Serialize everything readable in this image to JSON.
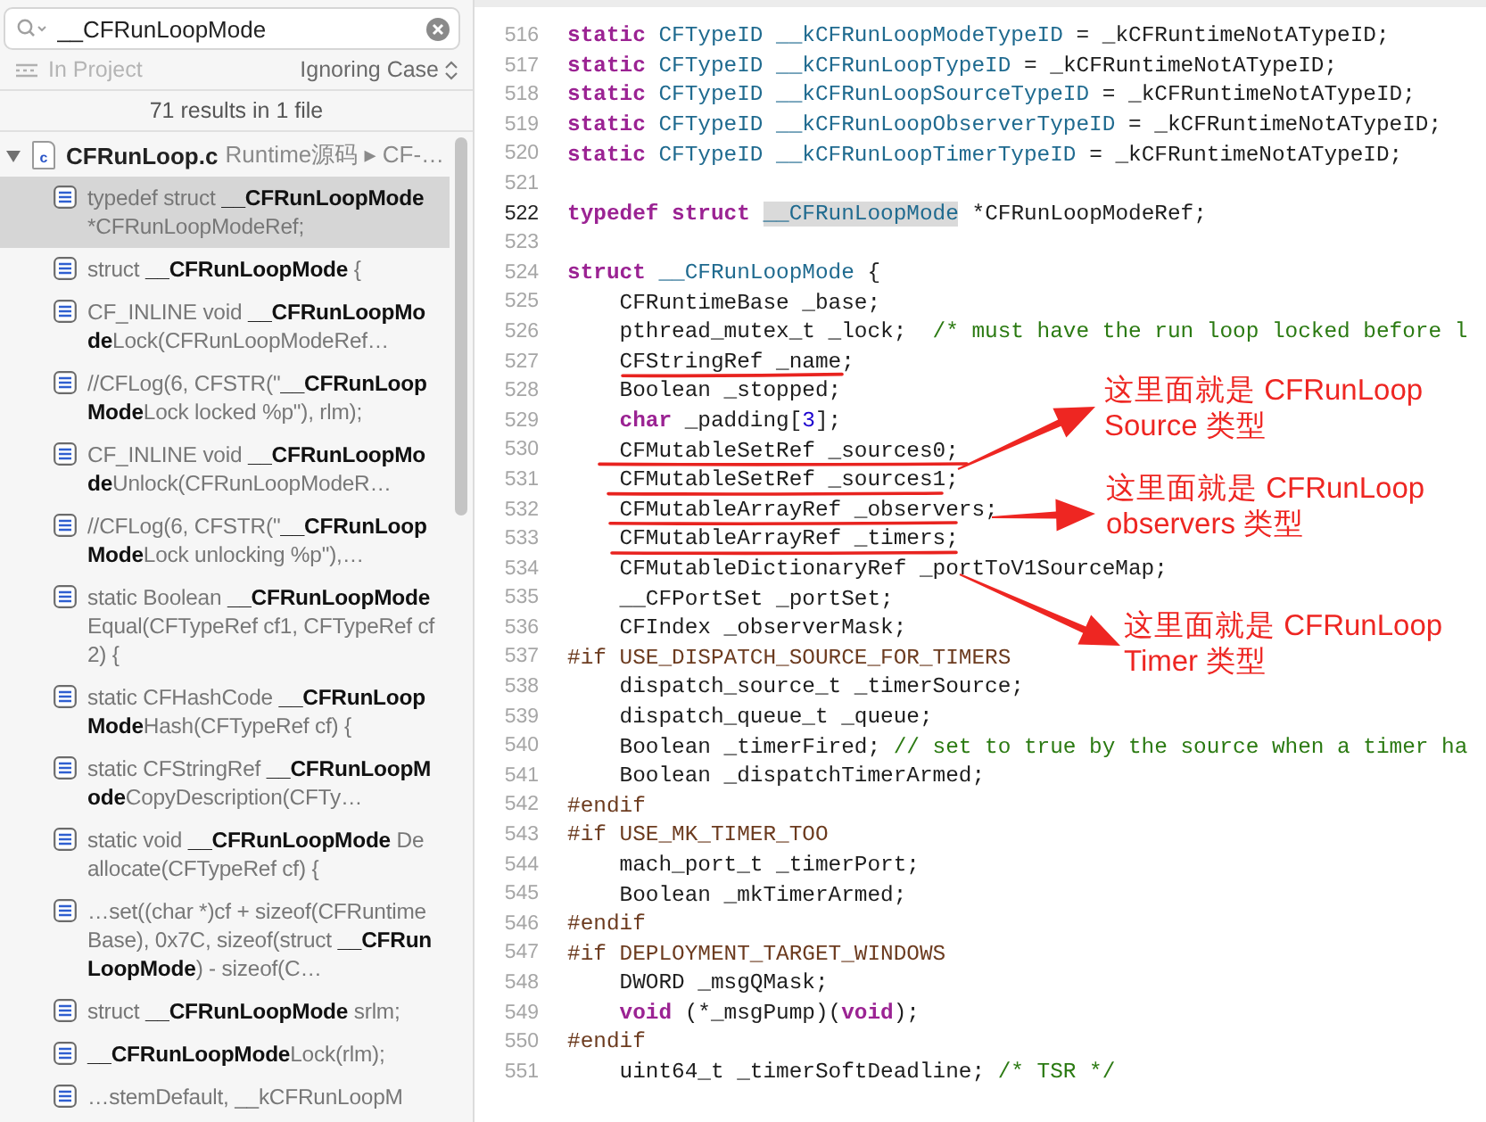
{
  "search": {
    "value": "__CFRunLoopMode"
  },
  "scope": {
    "label": "In Project"
  },
  "matching": {
    "label": "Ignoring Case"
  },
  "summary": "71 results in 1 file",
  "file": {
    "name": "CFRunLoop.c",
    "type_letter": "c",
    "path": "Runtime源码 ▸ CF-…",
    "expanded": true
  },
  "results": [
    {
      "text": "typedef struct **__CFRunLoopMode** *CFRunLoopModeRef;",
      "selected": true
    },
    {
      "text": "struct **__CFRunLoopMode** {",
      "selected": false
    },
    {
      "text": "CF_INLINE void **__CFRunLoopMode**Lock(CFRunLoopModeRef…",
      "selected": false
    },
    {
      "text": "//CFLog(6, CFSTR(\"**__CFRunLoopMode**Lock locked %p\"), rlm);",
      "selected": false
    },
    {
      "text": "CF_INLINE void **__CFRunLoopMode**Unlock(CFRunLoopModeR…",
      "selected": false
    },
    {
      "text": "//CFLog(6, CFSTR(\"**__CFRunLoopMode**Lock unlocking %p\"),…",
      "selected": false
    },
    {
      "text": "static Boolean **__CFRunLoopMode**Equal(CFTypeRef cf1, CFTypeRef cf2) {",
      "selected": false
    },
    {
      "text": "static CFHashCode **__CFRunLoopMode**Hash(CFTypeRef cf) {",
      "selected": false
    },
    {
      "text": "static CFStringRef **__CFRunLoopMode**CopyDescription(CFTy…",
      "selected": false
    },
    {
      "text": "static void **__CFRunLoopMode** Deallocate(CFTypeRef cf) {",
      "selected": false
    },
    {
      "text": "…set((char *)cf + sizeof(CFRuntimeBase), 0x7C, sizeof(struct **__CFRunLoopMode**) - sizeof(C…",
      "selected": false
    },
    {
      "text": "struct **__CFRunLoopMode** srlm;",
      "selected": false
    },
    {
      "text": "**__CFRunLoopMode**Lock(rlm);",
      "selected": false
    },
    {
      "text": "…stemDefault, __kCFRunLoopM",
      "selected": false
    }
  ],
  "code": {
    "lines": [
      {
        "number": "516",
        "current": false,
        "tokens": [
          {
            "kind": "kw",
            "text": "static"
          },
          {
            "kind": "type",
            "text": " CFTypeID"
          },
          {
            "kind": "type",
            "text": " __kCFRunLoopModeTypeID"
          },
          {
            "kind": "plain",
            "text": " = _kCFRuntimeNotATypeID;"
          }
        ]
      },
      {
        "number": "517",
        "current": false,
        "tokens": [
          {
            "kind": "kw",
            "text": "static"
          },
          {
            "kind": "type",
            "text": " CFTypeID"
          },
          {
            "kind": "type",
            "text": " __kCFRunLoopTypeID"
          },
          {
            "kind": "plain",
            "text": " = _kCFRuntimeNotATypeID;"
          }
        ]
      },
      {
        "number": "518",
        "current": false,
        "tokens": [
          {
            "kind": "kw",
            "text": "static"
          },
          {
            "kind": "type",
            "text": " CFTypeID"
          },
          {
            "kind": "type",
            "text": " __kCFRunLoopSourceTypeID"
          },
          {
            "kind": "plain",
            "text": " = _kCFRuntimeNotATypeID;"
          }
        ]
      },
      {
        "number": "519",
        "current": false,
        "tokens": [
          {
            "kind": "kw",
            "text": "static"
          },
          {
            "kind": "type",
            "text": " CFTypeID"
          },
          {
            "kind": "type",
            "text": " __kCFRunLoopObserverTypeID"
          },
          {
            "kind": "plain",
            "text": " = _kCFRuntimeNotATypeID;"
          }
        ]
      },
      {
        "number": "520",
        "current": false,
        "tokens": [
          {
            "kind": "kw",
            "text": "static"
          },
          {
            "kind": "type",
            "text": " CFTypeID"
          },
          {
            "kind": "type",
            "text": " __kCFRunLoopTimerTypeID"
          },
          {
            "kind": "plain",
            "text": " = _kCFRuntimeNotATypeID;"
          }
        ]
      },
      {
        "number": "521",
        "current": false
      },
      {
        "number": "522",
        "current": true,
        "tokens": [
          {
            "kind": "kw",
            "text": "typedef"
          },
          {
            "kind": "kw",
            "text": " struct "
          },
          {
            "kind": "match",
            "text": "__CFRunLoopMode"
          },
          {
            "kind": "plain",
            "text": " *CFRunLoopModeRef;"
          }
        ]
      },
      {
        "number": "523",
        "current": false
      },
      {
        "number": "524",
        "current": false,
        "tokens": [
          {
            "kind": "kw",
            "text": "struct"
          },
          {
            "kind": "type",
            "text": " __CFRunLoopMode"
          },
          {
            "kind": "plain",
            "text": " {"
          }
        ]
      },
      {
        "number": "525",
        "current": false,
        "tokens": [
          {
            "kind": "plain",
            "text": "    CFRuntimeBase _base;"
          }
        ]
      },
      {
        "number": "526",
        "current": false,
        "tokens": [
          {
            "kind": "plain",
            "text": "    pthread_mutex_t _lock;  "
          },
          {
            "kind": "comment",
            "text": "/* must have the run loop locked before l"
          }
        ]
      },
      {
        "number": "527",
        "current": false,
        "tokens": [
          {
            "kind": "plain",
            "text": "    CFStringRef _name;"
          }
        ]
      },
      {
        "number": "528",
        "current": false,
        "tokens": [
          {
            "kind": "plain",
            "text": "    Boolean _stopped;"
          }
        ]
      },
      {
        "number": "529",
        "current": false,
        "tokens": [
          {
            "kind": "kw",
            "text": "    char"
          },
          {
            "kind": "plain",
            "text": " _padding["
          },
          {
            "kind": "num",
            "text": "3"
          },
          {
            "kind": "plain",
            "text": "];"
          }
        ]
      },
      {
        "number": "530",
        "current": false,
        "tokens": [
          {
            "kind": "plain",
            "text": "    CFMutableSetRef _sources0;"
          }
        ]
      },
      {
        "number": "531",
        "current": false,
        "tokens": [
          {
            "kind": "plain",
            "text": "    CFMutableSetRef _sources1;"
          }
        ]
      },
      {
        "number": "532",
        "current": false,
        "tokens": [
          {
            "kind": "plain",
            "text": "    CFMutableArrayRef _observers;"
          }
        ]
      },
      {
        "number": "533",
        "current": false,
        "tokens": [
          {
            "kind": "plain",
            "text": "    CFMutableArrayRef _timers;"
          }
        ]
      },
      {
        "number": "534",
        "current": false,
        "tokens": [
          {
            "kind": "plain",
            "text": "    CFMutableDictionaryRef _portToV1SourceMap;"
          }
        ]
      },
      {
        "number": "535",
        "current": false,
        "tokens": [
          {
            "kind": "plain",
            "text": "    __CFPortSet _portSet;"
          }
        ]
      },
      {
        "number": "536",
        "current": false,
        "tokens": [
          {
            "kind": "plain",
            "text": "    CFIndex _observerMask;"
          }
        ]
      },
      {
        "number": "537",
        "current": false,
        "tokens": [
          {
            "kind": "pp",
            "text": "#if USE_DISPATCH_SOURCE_FOR_TIMERS"
          }
        ]
      },
      {
        "number": "538",
        "current": false,
        "tokens": [
          {
            "kind": "plain",
            "text": "    dispatch_source_t _timerSource;"
          }
        ]
      },
      {
        "number": "539",
        "current": false,
        "tokens": [
          {
            "kind": "plain",
            "text": "    dispatch_queue_t _queue;"
          }
        ]
      },
      {
        "number": "540",
        "current": false,
        "tokens": [
          {
            "kind": "plain",
            "text": "    Boolean _timerFired; "
          },
          {
            "kind": "comment",
            "text": "// set to true by the source when a timer ha"
          }
        ]
      },
      {
        "number": "541",
        "current": false,
        "tokens": [
          {
            "kind": "plain",
            "text": "    Boolean _dispatchTimerArmed;"
          }
        ]
      },
      {
        "number": "542",
        "current": false,
        "tokens": [
          {
            "kind": "pp",
            "text": "#endif"
          }
        ]
      },
      {
        "number": "543",
        "current": false,
        "tokens": [
          {
            "kind": "pp",
            "text": "#if USE_MK_TIMER_TOO"
          }
        ]
      },
      {
        "number": "544",
        "current": false,
        "tokens": [
          {
            "kind": "plain",
            "text": "    mach_port_t _timerPort;"
          }
        ]
      },
      {
        "number": "545",
        "current": false,
        "tokens": [
          {
            "kind": "plain",
            "text": "    Boolean _mkTimerArmed;"
          }
        ]
      },
      {
        "number": "546",
        "current": false,
        "tokens": [
          {
            "kind": "pp",
            "text": "#endif"
          }
        ]
      },
      {
        "number": "547",
        "current": false,
        "tokens": [
          {
            "kind": "pp",
            "text": "#if DEPLOYMENT_TARGET_WINDOWS"
          }
        ]
      },
      {
        "number": "548",
        "current": false,
        "tokens": [
          {
            "kind": "plain",
            "text": "    DWORD _msgQMask;"
          }
        ]
      },
      {
        "number": "549",
        "current": false,
        "tokens": [
          {
            "kind": "kw",
            "text": "    void"
          },
          {
            "kind": "plain",
            "text": " (*_msgPump)("
          },
          {
            "kind": "kw",
            "text": "void"
          },
          {
            "kind": "plain",
            "text": ");"
          }
        ]
      },
      {
        "number": "550",
        "current": false,
        "tokens": [
          {
            "kind": "pp",
            "text": "#endif"
          }
        ]
      },
      {
        "number": "551",
        "current": false,
        "tokens": [
          {
            "kind": "plain",
            "text": "    uint64_t _timerSoftDeadline; "
          },
          {
            "kind": "comment",
            "text": "/* TSR */"
          }
        ]
      }
    ]
  },
  "annotations": [
    {
      "lines": [
        "这里面就是 CFRunLoop",
        "Source 类型"
      ]
    },
    {
      "lines": [
        "这里面就是 CFRunLoop",
        "observers 类型"
      ]
    },
    {
      "lines": [
        "这里面就是 CFRunLoop",
        "Timer 类型"
      ]
    }
  ]
}
